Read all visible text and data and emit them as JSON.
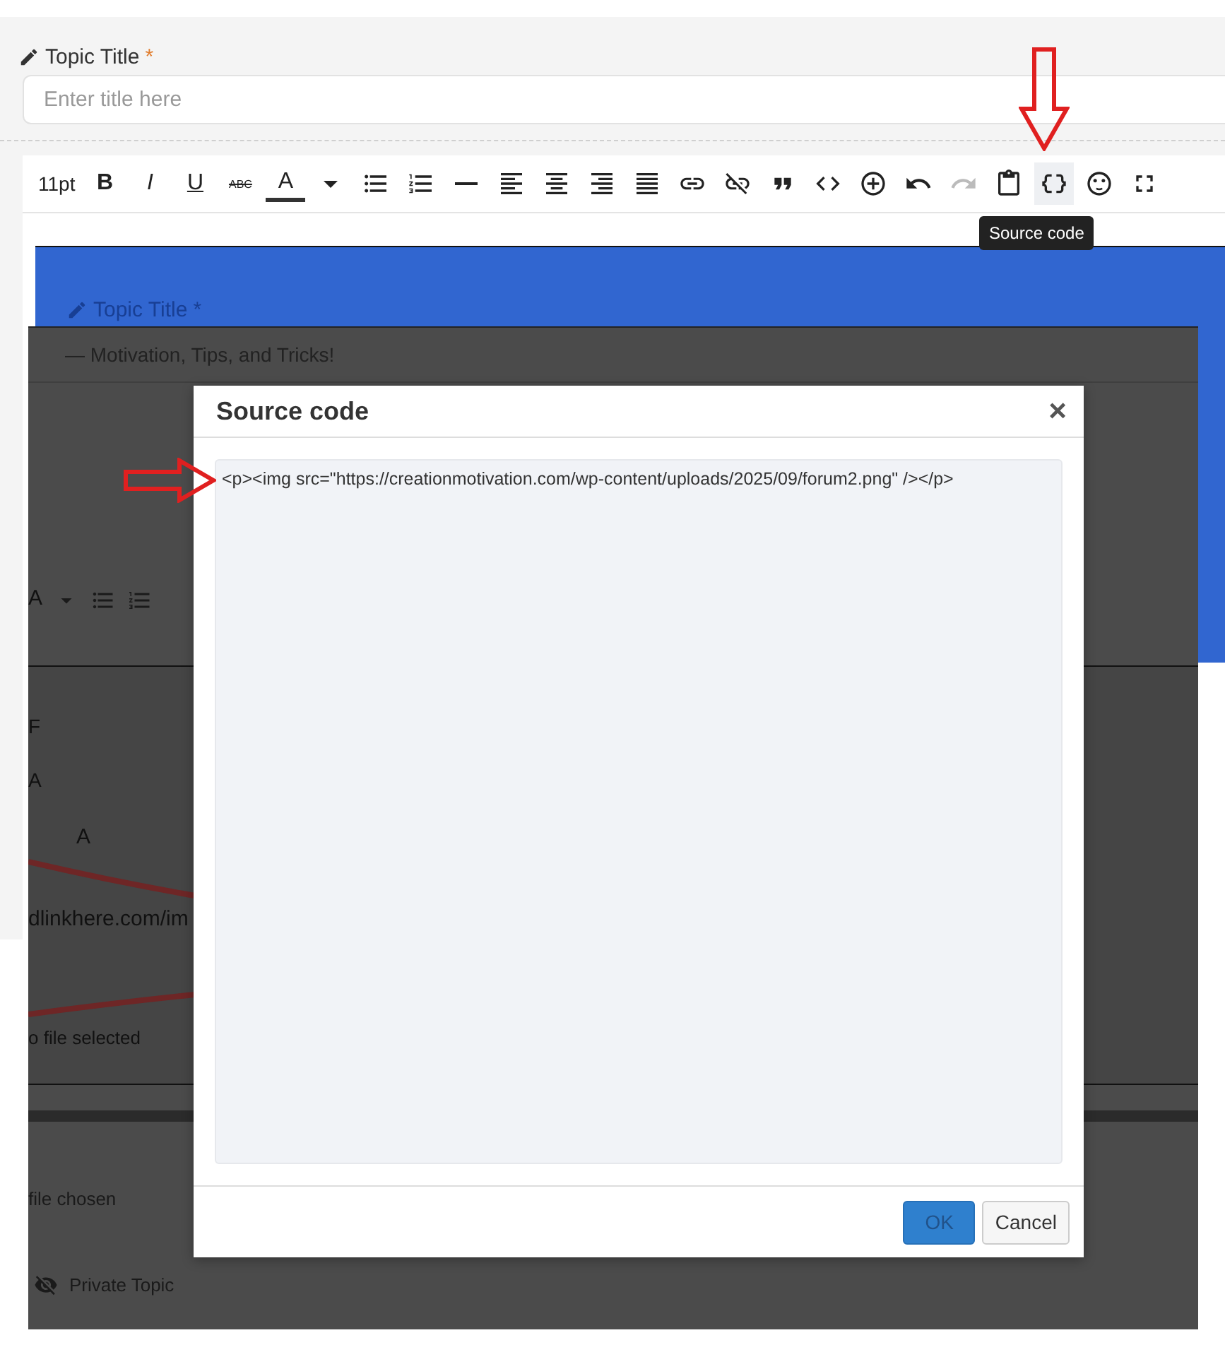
{
  "title_field": {
    "label": "Topic Title",
    "required_mark": "*",
    "placeholder": "Enter title here"
  },
  "toolbar": [
    {
      "kind": "size",
      "label": "11pt",
      "disabled": false,
      "hovered": false
    },
    {
      "kind": "bold",
      "label": "B",
      "disabled": false,
      "hovered": false
    },
    {
      "kind": "italic",
      "label": "I",
      "disabled": false,
      "hovered": false
    },
    {
      "kind": "underline",
      "label": "U",
      "disabled": false,
      "hovered": false
    },
    {
      "kind": "strike",
      "label": "ABC",
      "disabled": false,
      "hovered": false
    },
    {
      "kind": "color",
      "label": "A",
      "disabled": false,
      "hovered": false
    },
    {
      "kind": "icon",
      "disabled": false,
      "hovered": false
    },
    {
      "kind": "icon",
      "disabled": false,
      "hovered": false
    },
    {
      "kind": "icon",
      "disabled": false,
      "hovered": false
    },
    {
      "kind": "icon",
      "disabled": false,
      "hovered": false
    },
    {
      "kind": "icon",
      "disabled": false,
      "hovered": false
    },
    {
      "kind": "icon",
      "disabled": false,
      "hovered": false
    },
    {
      "kind": "icon",
      "disabled": false,
      "hovered": false
    },
    {
      "kind": "icon",
      "disabled": false,
      "hovered": false
    },
    {
      "kind": "icon",
      "disabled": false,
      "hovered": false
    },
    {
      "kind": "icon",
      "disabled": false,
      "hovered": false
    },
    {
      "kind": "icon",
      "disabled": false,
      "hovered": false
    },
    {
      "kind": "icon",
      "disabled": false,
      "hovered": false
    },
    {
      "kind": "icon",
      "disabled": false,
      "hovered": false
    },
    {
      "kind": "icon",
      "disabled": false,
      "hovered": false
    },
    {
      "kind": "icon",
      "disabled": true,
      "hovered": false
    },
    {
      "kind": "icon",
      "disabled": false,
      "hovered": false
    },
    {
      "kind": "icon",
      "disabled": false,
      "hovered": true
    },
    {
      "kind": "icon",
      "disabled": false,
      "hovered": false
    },
    {
      "kind": "icon",
      "disabled": false,
      "hovered": false
    }
  ],
  "tooltip": "Source code",
  "embedded_screenshot": {
    "title_label": "Topic Title",
    "required_mark": "*",
    "heading": "— Motivation, Tips, and Tricks!",
    "toolbar_letter": "A",
    "field_labels": [
      "F",
      "A"
    ],
    "second_toolbar_letter": "A",
    "url_fragment": "dlinkhere.com/im",
    "file_status": "o file selected",
    "file_chosen": "file chosen",
    "private_topic": "Private Topic"
  },
  "dialog": {
    "title": "Source code",
    "close": "×",
    "code": "<p><img src=\"https://creationmotivation.com/wp-content/uploads/2025/09/forum2.png\" /></p>",
    "buttons": [
      {
        "label": "OK",
        "kind": "primary"
      },
      {
        "label": "Cancel",
        "kind": "secondary"
      }
    ]
  }
}
